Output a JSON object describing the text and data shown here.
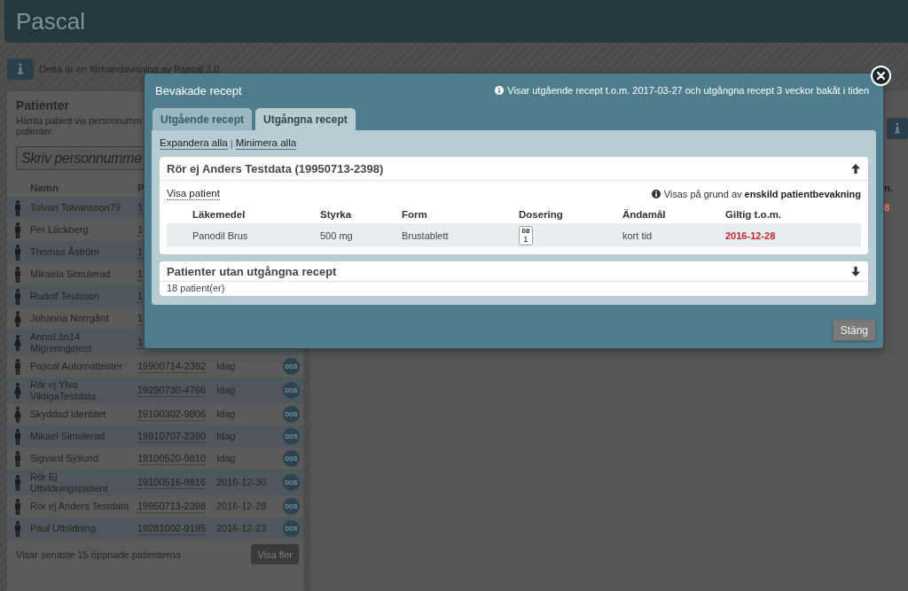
{
  "header": {
    "title": "Pascal"
  },
  "notice": {
    "text": "Detta är en förhandsvisning av Pascal 2.0."
  },
  "patients_panel": {
    "title": "Patienter",
    "subtitle_lines": [
      "Hämta patient via personnumm",
      "patienter."
    ],
    "search": {
      "placeholder": "Skriv personnumme"
    },
    "columns": [
      "Namn",
      "P"
    ],
    "rows": [
      {
        "kind": "male",
        "name": "Tolvan Tolvansson79",
        "personnummer": "1"
      },
      {
        "kind": "male",
        "name": "Per Läckberg",
        "personnummer": "1"
      },
      {
        "kind": "male",
        "name": "Thomas Åström",
        "personnummer": "1"
      },
      {
        "kind": "male",
        "name": "Mikaela Simulerad",
        "personnummer": "1"
      },
      {
        "kind": "male",
        "name": "Rudolf Testsson",
        "personnummer": "1"
      },
      {
        "kind": "female",
        "name": "Johanna Norrgård",
        "personnummer": "1"
      },
      {
        "kind": "female",
        "name": "AnnaLän14 Migreringstest",
        "personnummer": "1"
      },
      {
        "kind": "male",
        "name": "Pascal Automattester",
        "personnummer": "19900714-2392",
        "last_opened": "Idag",
        "badge": "DOS"
      },
      {
        "kind": "female",
        "name": "Rör ej Ylva ViktigaTestdata",
        "personnummer": "19290730-4766",
        "last_opened": "Idag",
        "badge": "DOS"
      },
      {
        "kind": "female",
        "name": "Skyddad Identitet",
        "personnummer": "19100302-9806",
        "last_opened": "Idag",
        "badge": "DOS"
      },
      {
        "kind": "male",
        "name": "Mikael Simulerad",
        "personnummer": "19910707-2390",
        "last_opened": "Idag",
        "badge": "DOS"
      },
      {
        "kind": "male",
        "name": "Sigvard Sjölund",
        "personnummer": "19100520-9810",
        "last_opened": "Idag",
        "badge": "DOS"
      },
      {
        "kind": "male",
        "name": "Rör Ej Utbildningspatient",
        "personnummer": "19100516-9816",
        "last_opened": "2016-12-30",
        "badge": "DOS"
      },
      {
        "kind": "male",
        "name": "Rör ej Anders Testdata",
        "personnummer": "19950713-2398",
        "last_opened": "2016-12-28",
        "badge": "DOS"
      },
      {
        "kind": "male",
        "name": "Paul Utbildning",
        "personnummer": "19281002-9195",
        "last_opened": "2016-12-23",
        "badge": "DOS"
      }
    ],
    "footer": "Visar senaste 15 öppnade patienterna",
    "more_button": "Visa fler"
  },
  "right_edge": {
    "heading_fragment": "n.",
    "cell_fragment": "8"
  },
  "dialog": {
    "title": "Bevakade recept",
    "info": "Visar utgående recept t.o.m. 2017-03-27 och utgångna recept 3 veckor bakåt i tiden",
    "tabs": [
      {
        "label": "Utgående recept",
        "selected": false
      },
      {
        "label": "Utgångna recept",
        "selected": true
      }
    ],
    "actions": [
      "Expandera alla",
      "Minimera alla"
    ],
    "separator": "|",
    "groups": [
      {
        "title": "Rör ej Anders Testdata (19950713-2398)",
        "expanded": true,
        "link": "Visa patient",
        "note": "Visas på grund av **enskild patientbevakning**",
        "columns": [
          "Läkemedel",
          "Styrka",
          "Form",
          "Dosering",
          "Ändamål",
          "Giltig t.o.m."
        ],
        "rows": [
          {
            "medicine": "Panodil Brus",
            "strength": "500 mg",
            "form": "Brustablett",
            "dosage": {
              "time": "08",
              "amount": "1"
            },
            "purpose": "kort tid",
            "valid_until": "2016-12-28",
            "expired": true
          }
        ]
      },
      {
        "title": "Patienter utan utgångna recept",
        "expanded": false,
        "summary": "18 patient(er)"
      }
    ],
    "close_button": "Stäng"
  }
}
